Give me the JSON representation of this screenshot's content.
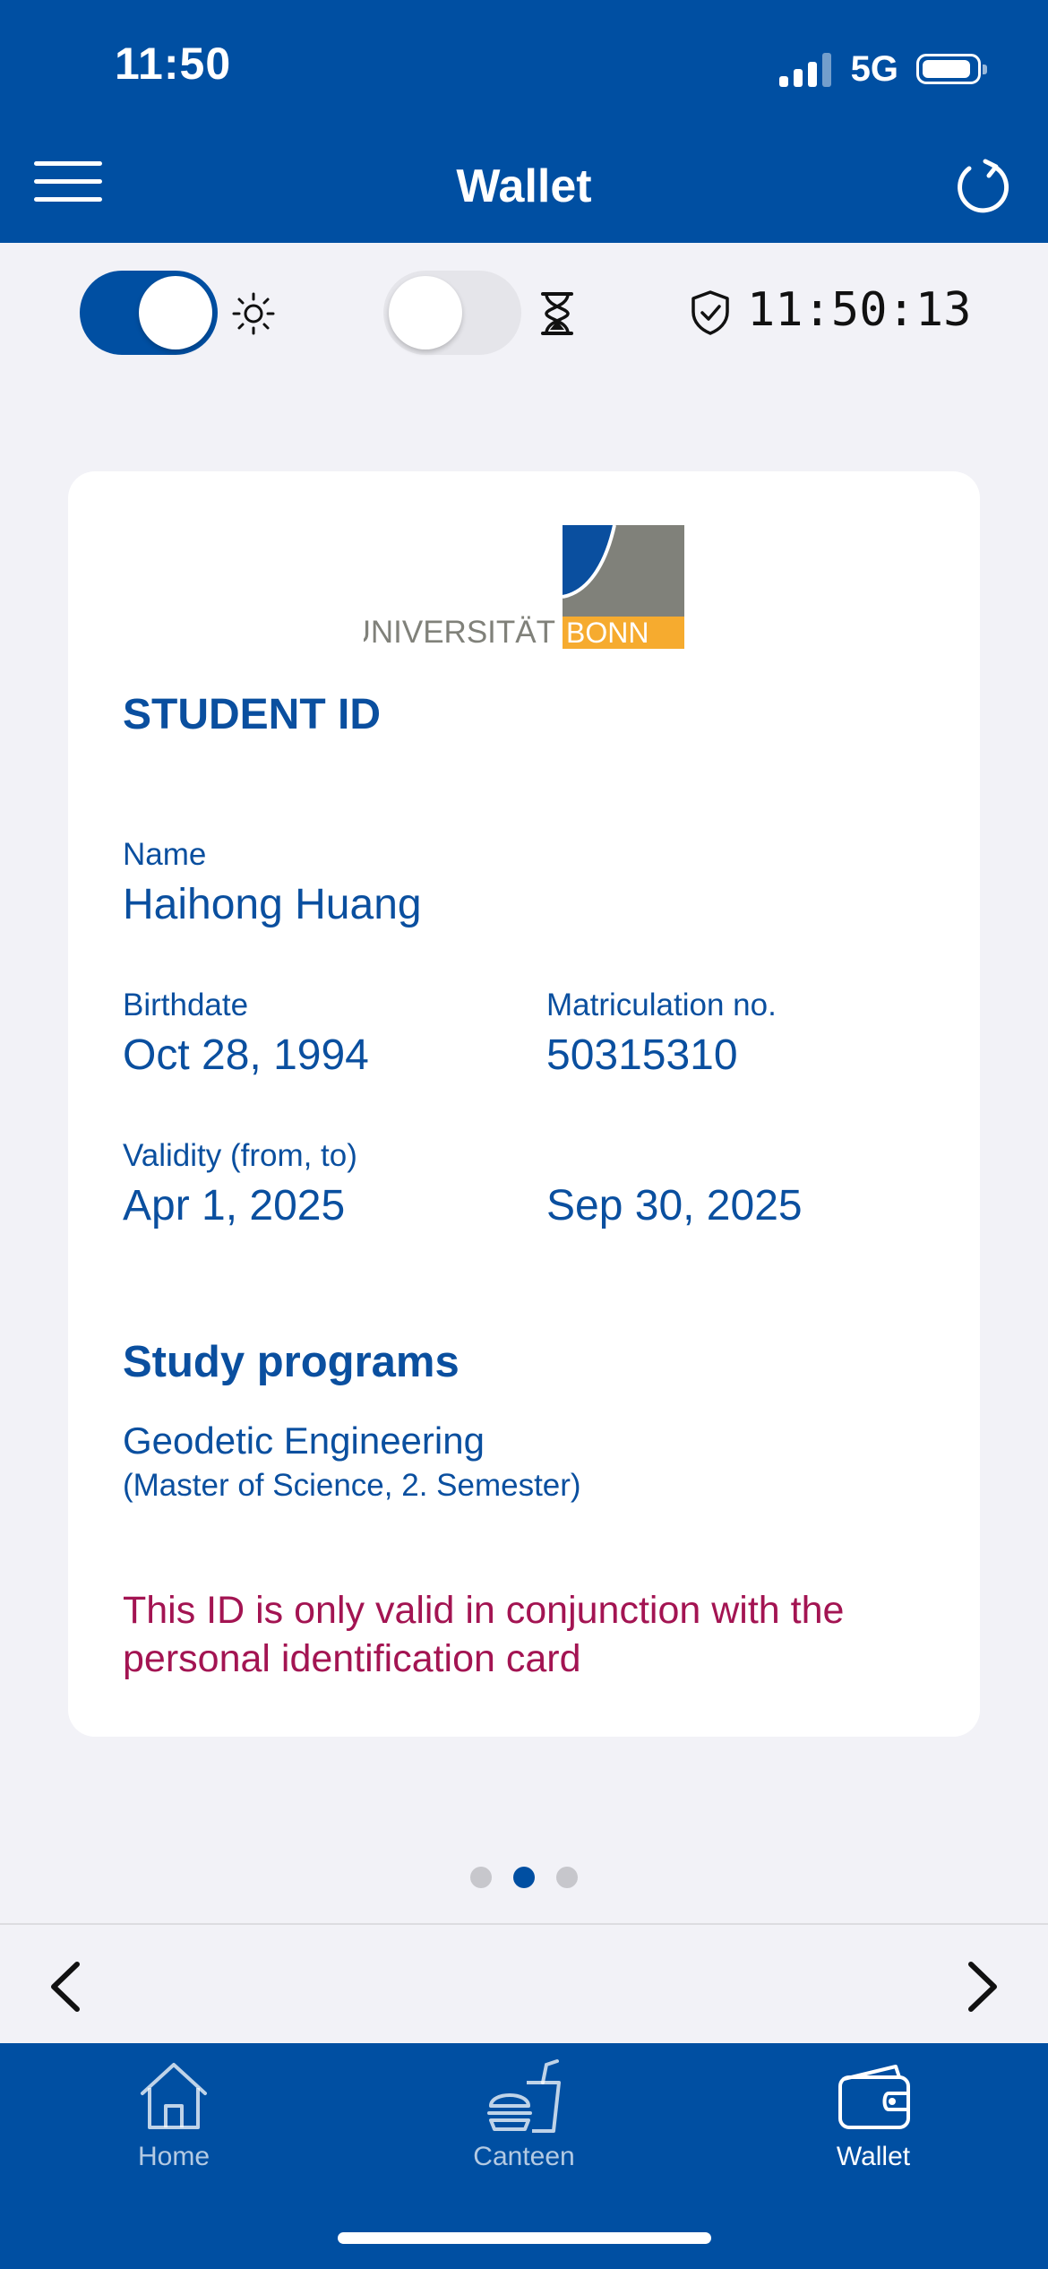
{
  "status": {
    "time": "11:50",
    "network": "5G"
  },
  "header": {
    "title": "Wallet"
  },
  "controls": {
    "clock": "11:50:13",
    "brightness_toggle_on": true,
    "timer_toggle_on": false
  },
  "card": {
    "logo": {
      "text_main": "UNIVERSITÄT",
      "text_accent": "BONN"
    },
    "title": "STUDENT ID",
    "name_label": "Name",
    "name_value": "Haihong Huang",
    "birthdate_label": "Birthdate",
    "birthdate_value": "Oct 28, 1994",
    "matriculation_label": "Matriculation no.",
    "matriculation_value": "50315310",
    "validity_label": "Validity (from, to)",
    "validity_from": "Apr 1, 2025",
    "validity_to": "Sep 30, 2025",
    "programs_title": "Study programs",
    "program_name": "Geodetic Engineering",
    "program_detail": "(Master of Science, 2. Semester)",
    "notice": "This ID is only valid in conjunction with the personal identification card"
  },
  "pagination": {
    "count": 3,
    "active_index": 1
  },
  "tabs": [
    {
      "label": "Home",
      "icon": "home-icon"
    },
    {
      "label": "Canteen",
      "icon": "canteen-icon"
    },
    {
      "label": "Wallet",
      "icon": "wallet-icon"
    }
  ],
  "colors": {
    "brand": "#004fa2",
    "notice": "#a31452",
    "logo_gray": "#80817a",
    "logo_yellow": "#f6ab2f"
  }
}
